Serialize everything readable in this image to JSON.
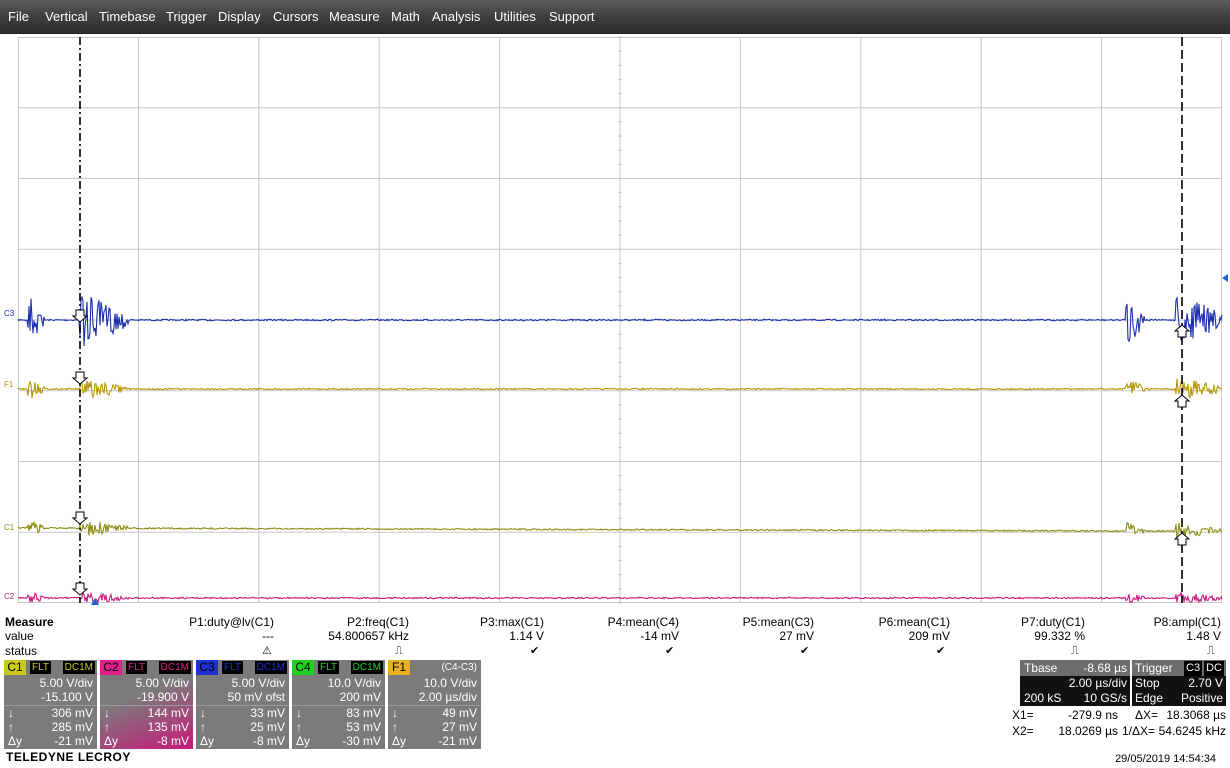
{
  "menu": [
    "File",
    "Vertical",
    "Timebase",
    "Trigger",
    "Display",
    "Cursors",
    "Measure",
    "Math",
    "Analysis",
    "Utilities",
    "Support"
  ],
  "traces": {
    "C3": {
      "label": "C3",
      "color": "#1a2fb0"
    },
    "F1": {
      "label": "F1",
      "color": "#b8960a"
    },
    "C1": {
      "label": "C1",
      "color": "#8e8e15"
    },
    "C2": {
      "label": "C2",
      "color": "#c8197a"
    }
  },
  "measure": {
    "title": "Measure",
    "row_labels": [
      "value",
      "status"
    ],
    "params": [
      {
        "name": "P1:duty@lv(C1)",
        "value": "---",
        "status": "⚠"
      },
      {
        "name": "P2:freq(C1)",
        "value": "54.800657 kHz",
        "status": "⎍"
      },
      {
        "name": "P3:max(C1)",
        "value": "1.14 V",
        "status": "✔"
      },
      {
        "name": "P4:mean(C4)",
        "value": "-14 mV",
        "status": "✔"
      },
      {
        "name": "P5:mean(C3)",
        "value": "27 mV",
        "status": "✔"
      },
      {
        "name": "P6:mean(C1)",
        "value": "209 mV",
        "status": "✔"
      },
      {
        "name": "P7:duty(C1)",
        "value": "99.332 %",
        "status": "⎍"
      },
      {
        "name": "P8:ampl(C1)",
        "value": "1.48 V",
        "status": "⎍"
      }
    ]
  },
  "channels": [
    {
      "id": "C1",
      "color": "#c8c81e",
      "tag1": "FLT",
      "tag2": "DC1M",
      "scale": "5.00 V/div",
      "offset": "-15.100 V",
      "down": "306 mV",
      "up": "285 mV",
      "dy": "-21 mV"
    },
    {
      "id": "C2",
      "color": "#e0208a",
      "tag1": "FLT",
      "tag2": "DC1M",
      "scale": "5.00 V/div",
      "offset": "-19.900 V",
      "down": "144 mV",
      "up": "135 mV",
      "dy": "-8 mV"
    },
    {
      "id": "C3",
      "color": "#2030d0",
      "tag1": "FLT",
      "tag2": "DC1M",
      "scale": "5.00 V/div",
      "offset": "50 mV ofst",
      "down": "33 mV",
      "up": "25 mV",
      "dy": "-8 mV"
    },
    {
      "id": "C4",
      "color": "#22d022",
      "tag1": "FLT",
      "tag2": "DC1M",
      "scale": "10.0 V/div",
      "offset": "200 mV",
      "down": "83 mV",
      "up": "53 mV",
      "dy": "-30 mV"
    },
    {
      "id": "F1",
      "color": "#e8b020",
      "tag1": "",
      "tag2": "(C4-C3)",
      "scale": "10.0 V/div",
      "offset": "2.00 µs/div",
      "down": "49 mV",
      "up": "27 mV",
      "dy": "-21 mV"
    }
  ],
  "tbase": {
    "label": "Tbase",
    "delay": "-8.68 µs",
    "div": "2.00 µs/div",
    "samples": "200 kS",
    "rate": "10 GS/s"
  },
  "trigger": {
    "label": "Trigger",
    "source": "C3",
    "coupling": "DC",
    "mode": "Stop",
    "level": "2.70 V",
    "type": "Edge",
    "slope": "Positive"
  },
  "cursors": {
    "x1_label": "X1=",
    "x1": "-279.9 ns",
    "dx_label": "ΔX=",
    "dx": "18.3068 µs",
    "x2_label": "X2=",
    "x2": "18.0269 µs",
    "inv_label": "1/ΔX=",
    "inv": "54.6245 kHz"
  },
  "brand": "TELEDYNE LECROY",
  "timestamp": "29/05/2019 14:54:34",
  "icons": {
    "down_cursor": "down-arrow-icon",
    "up_cursor": "up-arrow-icon",
    "dy": "delta-y-icon"
  },
  "colors": {
    "grid": "#c8c8c8",
    "menubar": "#3c3c3c",
    "panel": "#7b7b7b"
  }
}
